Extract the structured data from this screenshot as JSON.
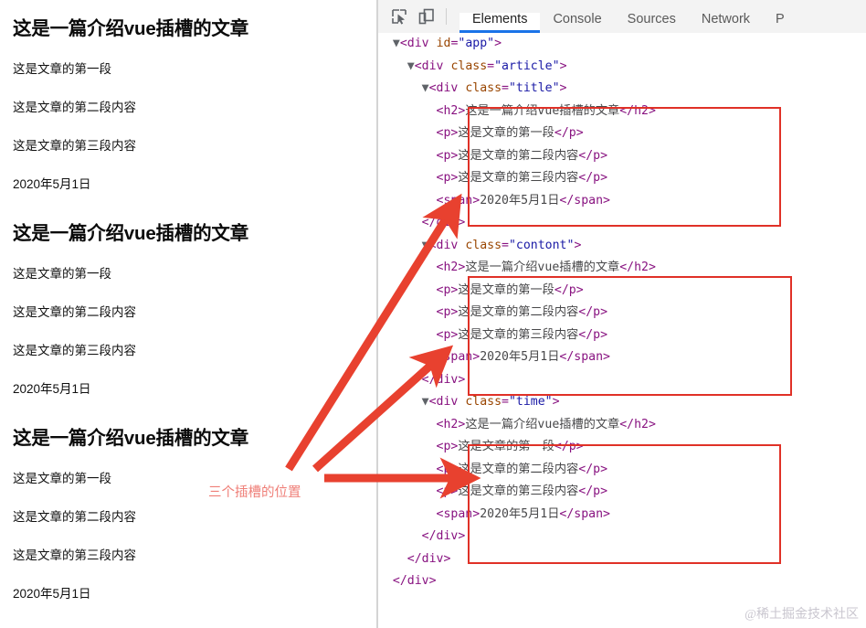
{
  "page_preview": {
    "blocks": [
      {
        "heading": "这是一篇介绍vue插槽的文章",
        "p1": "这是文章的第一段",
        "p2": "这是文章的第二段内容",
        "p3": "这是文章的第三段内容",
        "date": "2020年5月1日"
      },
      {
        "heading": "这是一篇介绍vue插槽的文章",
        "p1": "这是文章的第一段",
        "p2": "这是文章的第二段内容",
        "p3": "这是文章的第三段内容",
        "date": "2020年5月1日"
      },
      {
        "heading": "这是一篇介绍vue插槽的文章",
        "p1": "这是文章的第一段",
        "p2": "这是文章的第二段内容",
        "p3": "这是文章的第三段内容",
        "date": "2020年5月1日"
      }
    ]
  },
  "devtools": {
    "icons": {
      "inspect": "inspect-element-icon",
      "device": "device-toolbar-icon"
    },
    "tabs": [
      {
        "label": "Elements",
        "active": true
      },
      {
        "label": "Console",
        "active": false
      },
      {
        "label": "Sources",
        "active": false
      },
      {
        "label": "Network",
        "active": false
      },
      {
        "label": "P",
        "active": false
      }
    ],
    "dom": {
      "root_open": "<div id=\"app\">",
      "root_id_attr": "id",
      "root_id_val": "\"app\"",
      "article_attr": "class",
      "article_val": "\"article\"",
      "group_classes": [
        "\"title\"",
        "\"contont\"",
        "\"time\""
      ],
      "tag_div": "div",
      "tag_h2": "h2",
      "tag_p": "p",
      "tag_span": "span",
      "h2_text": "这是一篇介绍vue插槽的文章",
      "p1_text": "这是文章的第一段",
      "p2_text": "这是文章的第二段内容",
      "p3_text": "这是文章的第三段内容",
      "span_text": "2020年5月1日",
      "close_div": "</div>"
    }
  },
  "annotation": {
    "text": "三个插槽的位置",
    "color": "#ef7f78",
    "arrow_color": "#e8412f",
    "arrow_count": 3
  },
  "watermark": {
    "text": "@稀土掘金技术社区"
  },
  "colors": {
    "accent_tab": "#1a73e8",
    "highlight_box": "#e03127",
    "tag": "#881280",
    "attr_name": "#994500",
    "attr_value": "#1a1aa6",
    "text_node": "#48484a"
  }
}
